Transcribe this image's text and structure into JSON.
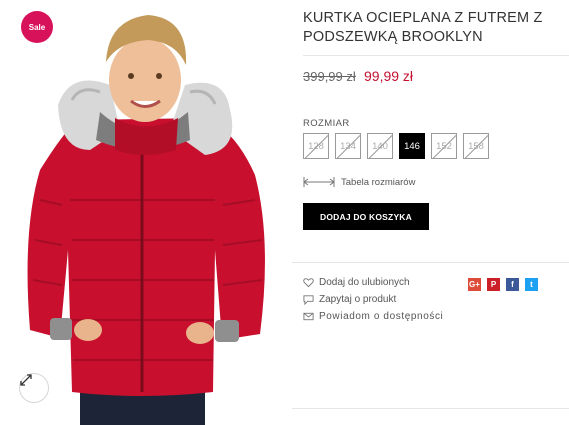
{
  "badge": {
    "label": "Sale"
  },
  "product": {
    "title": "KURTKA OCIEPLANA Z FUTREM Z PODSZEWKĄ BROOKLYN",
    "old_price": "399,99 zł",
    "new_price": "99,99 zł"
  },
  "size_selector": {
    "label": "ROZMIAR",
    "options": [
      {
        "label": "128",
        "state": "disabled"
      },
      {
        "label": "134",
        "state": "disabled"
      },
      {
        "label": "140",
        "state": "disabled"
      },
      {
        "label": "146",
        "state": "selected"
      },
      {
        "label": "152",
        "state": "disabled"
      },
      {
        "label": "158",
        "state": "disabled"
      }
    ],
    "size_table_label": "Tabela rozmiarów"
  },
  "cart": {
    "button_label": "DODAJ DO KOSZYKA"
  },
  "actions": {
    "wishlist": "Dodaj do ulubionych",
    "ask": "Zapytaj o produkt",
    "notify": "Powiadom o dostępności"
  },
  "social": {
    "google": {
      "label": "G+",
      "color": "#dd4b39"
    },
    "pinterest": {
      "label": "P",
      "color": "#cb2027"
    },
    "facebook": {
      "label": "f",
      "color": "#3b5998"
    },
    "twitter": {
      "label": "t",
      "color": "#1da1f2"
    }
  },
  "colors": {
    "accent": "#d8125a",
    "price": "#c4122f",
    "button": "#000000"
  }
}
